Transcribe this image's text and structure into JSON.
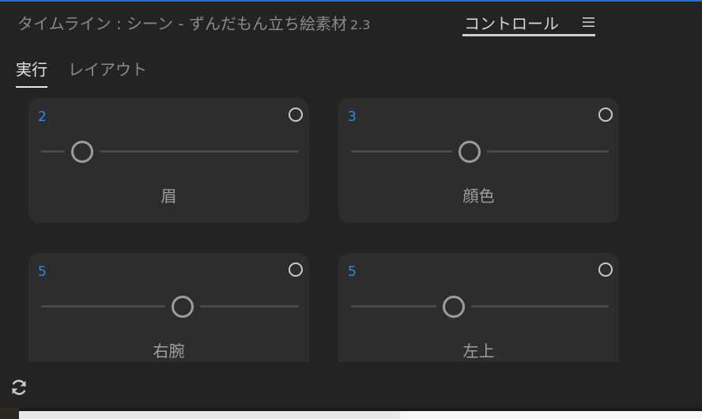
{
  "header": {
    "title": "タイムライン : シーン - ずんだもん立ち絵素材",
    "version": "2.3",
    "controls_tab_label": "コントロール",
    "menu_icon": "hamburger-menu-icon"
  },
  "tabs": [
    {
      "label": "実行",
      "active": true
    },
    {
      "label": "レイアウト",
      "active": false
    }
  ],
  "cards": [
    {
      "value": "2",
      "label": "眉",
      "slider_position": 0.16
    },
    {
      "value": "3",
      "label": "顔色",
      "slider_position": 0.46
    },
    {
      "value": "5",
      "label": "右腕",
      "slider_position": 0.55
    },
    {
      "value": "5",
      "label": "左上",
      "slider_position": 0.4
    }
  ],
  "footer": {
    "refresh_icon": "refresh-icon"
  },
  "colors": {
    "accent": "#1473e6",
    "value_text": "#2d8ceb",
    "panel_bg": "#232323",
    "card_bg": "#2d2d2d"
  }
}
